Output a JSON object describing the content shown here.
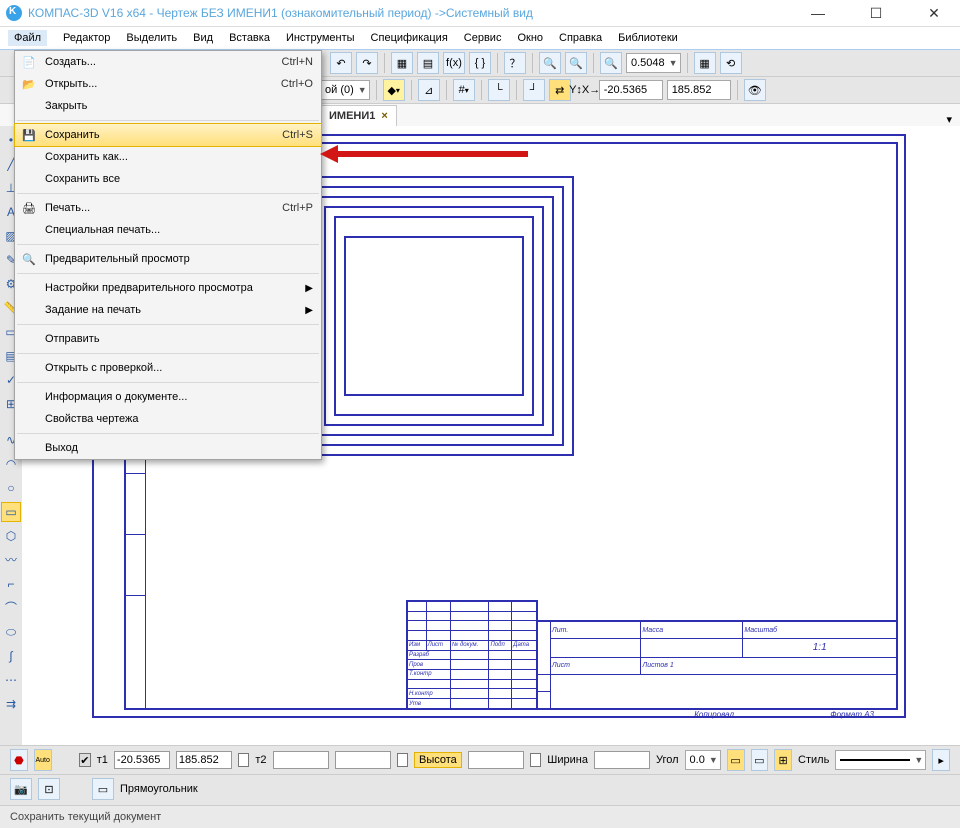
{
  "title": "КОМПАС-3D V16  x64 - Чертеж БЕЗ ИМЕНИ1 (ознакомительный период) ->Системный вид",
  "menubar": [
    "Файл",
    "Редактор",
    "Выделить",
    "Вид",
    "Вставка",
    "Инструменты",
    "Спецификация",
    "Сервис",
    "Окно",
    "Справка",
    "Библиотеки"
  ],
  "toolbar1": {
    "zoom_value": "0.5048"
  },
  "toolbar2": {
    "layer": "ой (0)",
    "coordX": "-20.5365",
    "coordY": "185.852"
  },
  "tab": {
    "label": "ИМЕНИ1",
    "close": "×"
  },
  "file_menu": [
    {
      "icon": "📄",
      "label": "Создать...",
      "shortcut": "Ctrl+N"
    },
    {
      "icon": "📂",
      "label": "Открыть...",
      "shortcut": "Ctrl+O"
    },
    {
      "label": "Закрыть"
    },
    {
      "sep": true
    },
    {
      "icon": "💾",
      "label": "Сохранить",
      "shortcut": "Ctrl+S",
      "hl": true
    },
    {
      "label": "Сохранить как..."
    },
    {
      "label": "Сохранить все"
    },
    {
      "sep": true
    },
    {
      "icon": "🖨",
      "label": "Печать...",
      "shortcut": "Ctrl+P"
    },
    {
      "label": "Специальная печать..."
    },
    {
      "sep": true
    },
    {
      "icon": "🔍",
      "label": "Предварительный просмотр"
    },
    {
      "sep": true
    },
    {
      "label": "Настройки предварительного просмотра",
      "sub": true
    },
    {
      "label": "Задание на печать",
      "sub": true
    },
    {
      "sep": true
    },
    {
      "label": "Отправить"
    },
    {
      "sep": true
    },
    {
      "label": "Открыть с проверкой..."
    },
    {
      "sep": true
    },
    {
      "label": "Информация о документе..."
    },
    {
      "label": "Свойства чертежа"
    },
    {
      "sep": true
    },
    {
      "label": "Выход"
    }
  ],
  "title_block": {
    "headers": [
      "Лит.",
      "Масса",
      "Масштаб"
    ],
    "rows": [
      "Разраб",
      "Пров",
      "Т.контр",
      "",
      "Н.контр",
      "Утв"
    ],
    "scale": "1:1",
    "sheet": [
      "Лист",
      "Листов  1"
    ]
  },
  "rev_table": {
    "cols": [
      "Изм",
      "Лист",
      "№ докум.",
      "Подп",
      "Дата"
    ]
  },
  "footer": {
    "copy": "Копировал",
    "format": "Формат   А3"
  },
  "props": {
    "t1": "т1",
    "x1": "-20.5365",
    "y1": "185.852",
    "t2": "т2",
    "height_lbl": "Высота",
    "width_lbl": "Ширина",
    "angle_lbl": "Угол",
    "angle": "0.0",
    "style_lbl": "Стиль",
    "shape_lbl": "Прямоугольник"
  },
  "status": "Сохранить текущий документ"
}
